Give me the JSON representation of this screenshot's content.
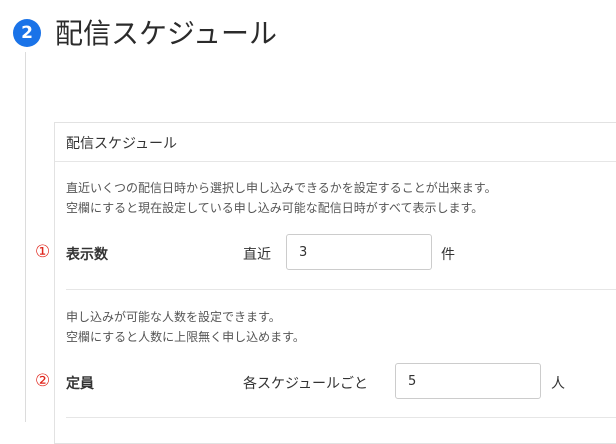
{
  "section": {
    "step_number": "2",
    "title": "配信スケジュール"
  },
  "panel": {
    "header": "配信スケジュール",
    "display_count": {
      "description_line1": "直近いくつの配信日時から選択し申し込みできるかを設定することが出来ます。",
      "description_line2": "空欄にすると現在設定している申し込み可能な配信日時がすべて表示します。",
      "marker": "①",
      "label": "表示数",
      "prefix": "直近",
      "value": "3",
      "unit": "件"
    },
    "capacity": {
      "description_line1": "申し込みが可能な人数を設定できます。",
      "description_line2": "空欄にすると人数に上限無く申し込めます。",
      "marker": "②",
      "label": "定員",
      "prefix": "各スケジュールごと",
      "value": "5",
      "unit": "人"
    }
  }
}
